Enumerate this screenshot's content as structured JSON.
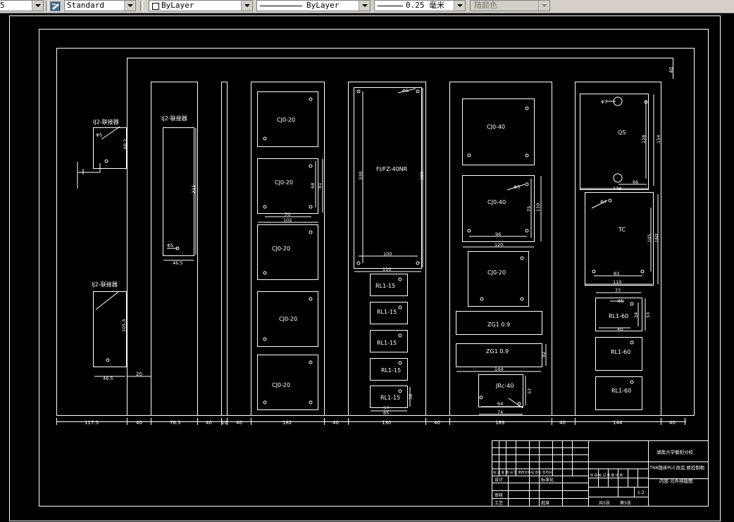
{
  "toolbar": {
    "layer_num": "5",
    "textstyle": "Standard",
    "layer": "ByLayer",
    "linetype": "ByLayer",
    "lineweight": "0.25 毫米",
    "color": "随颜色"
  },
  "drawing": {
    "dims": {
      "d1175": "117.5",
      "d40a": "40",
      "d765": "76.5",
      "d40b": "40",
      "d10": "10",
      "d40c": "40",
      "d182": "182",
      "d40d": "40",
      "d130": "130",
      "d40e": "40",
      "d189": "189",
      "d40f": "40",
      "d144": "144",
      "d40g": "40",
      "d40top": "40",
      "d20": "20"
    },
    "labels": {
      "ij2_top": "IJ2-联接器",
      "ij2_mid": "IJ2-联接器",
      "ij2_bot": "IJ2-联接器",
      "cj0_1": "CJ0-20",
      "cj0_2": "CJ0-20",
      "cj0_3": "CJ0-20",
      "cj0_4": "CJ0-20",
      "cj0_5": "CJ0-20",
      "fpga": "FI/FZ-40NR",
      "rl1": "RL1-15",
      "rl2": "RL1-15",
      "rl3": "RL1-15",
      "rl4": "RL1-15",
      "rl5": "RL1-15",
      "cj40a": "CJ0-40",
      "cj40b": "CJ0-40",
      "cj20c": "CJ0-20",
      "zg1": "ZG1 0.9",
      "zg2": "ZG1 0.9",
      "jr": "JRc-40",
      "qs": "QS",
      "tc": "TC",
      "rl60a": "RL1-60",
      "rl60b": "RL1-60",
      "rl60c": "RL1-60"
    },
    "inner_dims": {
      "a1": "68.2",
      "a2": "Φ5",
      "a3": "211",
      "a4": "46.5",
      "a5": "Φ5",
      "a6": "105.5",
      "a7": "46.5",
      "b1": "68",
      "b2": "81",
      "b3": "70",
      "b4": "102",
      "c1": "330",
      "c2": "380",
      "c3": "100",
      "c4": "110",
      "c5": "Φ5",
      "d1": "57",
      "d2": "65",
      "d3": "38",
      "e1": "75",
      "e2": "110",
      "e3": "96",
      "e4": "120",
      "e5": "Φ5",
      "e6": "144",
      "e7": "82",
      "e8": "57",
      "e9": "64",
      "e10": "74",
      "f1": "Φ7",
      "f2": "128",
      "f3": "154",
      "f4": "66",
      "f5": "134",
      "f6": "Φ7",
      "f7": "105",
      "f8": "160",
      "f9": "83",
      "f10": "110",
      "f11": "77",
      "f12": "65",
      "f13": "34",
      "f14": "53",
      "f15": "40"
    },
    "title_block": {
      "school": "湖南大学衡阳分校",
      "title1": "T68镗床PLC改造 原控制柜",
      "title2": "内部 元件排版图",
      "scale": "1:2",
      "sheet": "共5张",
      "sheet2": "第5张",
      "row_a": "标 记 处 数 分 区 更改文件号 签名 年月日",
      "design": "设计",
      "standard": "标准化",
      "stage": "阶 段 标 记 质 量 比 例",
      "review": "审核",
      "process": "工艺",
      "approve": "批准"
    }
  }
}
